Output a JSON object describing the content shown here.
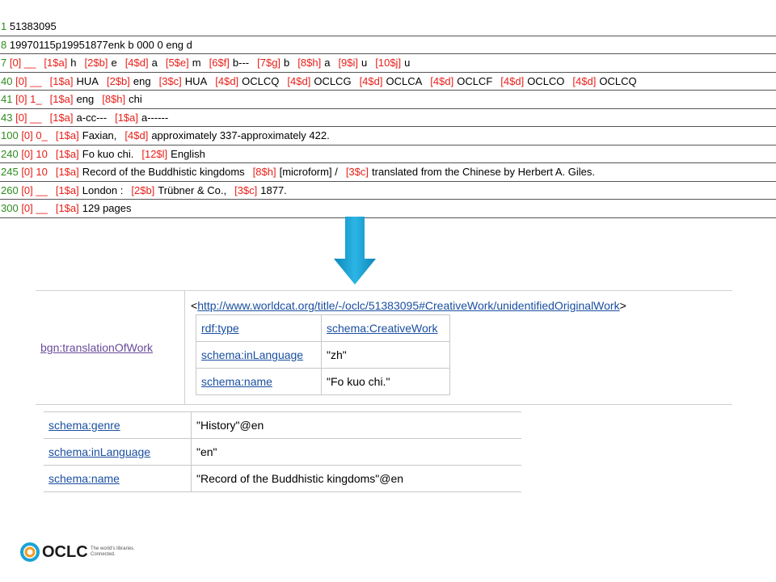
{
  "marc_rows": [
    {
      "tag": "1",
      "parts": [
        {
          "t": "51383095",
          "c": "plain"
        }
      ]
    },
    {
      "tag": "8",
      "parts": [
        {
          "t": "19970115p19951877enk b 000 0 eng d",
          "c": "plain"
        }
      ]
    },
    {
      "tag": "7",
      "parts": [
        {
          "t": "[0] __",
          "c": "sub"
        },
        {
          "t": "[1$a]",
          "c": "sub"
        },
        {
          "t": "h",
          "c": "plain"
        },
        {
          "t": "[2$b]",
          "c": "sub"
        },
        {
          "t": "e",
          "c": "plain"
        },
        {
          "t": "[4$d]",
          "c": "sub"
        },
        {
          "t": "a",
          "c": "plain"
        },
        {
          "t": "[5$e]",
          "c": "sub"
        },
        {
          "t": "m",
          "c": "plain"
        },
        {
          "t": "[6$f]",
          "c": "sub"
        },
        {
          "t": "b---",
          "c": "plain"
        },
        {
          "t": "[7$g]",
          "c": "sub"
        },
        {
          "t": "b",
          "c": "plain"
        },
        {
          "t": "[8$h]",
          "c": "sub"
        },
        {
          "t": "a",
          "c": "plain"
        },
        {
          "t": "[9$i]",
          "c": "sub"
        },
        {
          "t": "u",
          "c": "plain"
        },
        {
          "t": "[10$j]",
          "c": "sub"
        },
        {
          "t": "u",
          "c": "plain"
        }
      ]
    },
    {
      "tag": "40",
      "parts": [
        {
          "t": "[0] __",
          "c": "sub"
        },
        {
          "t": "[1$a]",
          "c": "sub"
        },
        {
          "t": "HUA",
          "c": "plain"
        },
        {
          "t": "[2$b]",
          "c": "sub"
        },
        {
          "t": "eng",
          "c": "plain"
        },
        {
          "t": "[3$c]",
          "c": "sub"
        },
        {
          "t": "HUA",
          "c": "plain"
        },
        {
          "t": "[4$d]",
          "c": "sub"
        },
        {
          "t": "OCLCQ",
          "c": "plain"
        },
        {
          "t": "[4$d]",
          "c": "sub"
        },
        {
          "t": "OCLCG",
          "c": "plain"
        },
        {
          "t": "[4$d]",
          "c": "sub"
        },
        {
          "t": "OCLCA",
          "c": "plain"
        },
        {
          "t": "[4$d]",
          "c": "sub"
        },
        {
          "t": "OCLCF",
          "c": "plain"
        },
        {
          "t": "[4$d]",
          "c": "sub"
        },
        {
          "t": "OCLCO",
          "c": "plain"
        },
        {
          "t": "[4$d]",
          "c": "sub"
        },
        {
          "t": "OCLCQ",
          "c": "plain"
        }
      ]
    },
    {
      "tag": "41",
      "parts": [
        {
          "t": "[0] 1_",
          "c": "sub"
        },
        {
          "t": "[1$a]",
          "c": "sub"
        },
        {
          "t": "eng",
          "c": "plain"
        },
        {
          "t": "[8$h]",
          "c": "sub"
        },
        {
          "t": "chi",
          "c": "plain"
        }
      ]
    },
    {
      "tag": "43",
      "parts": [
        {
          "t": "[0] __",
          "c": "sub"
        },
        {
          "t": "[1$a]",
          "c": "sub"
        },
        {
          "t": "a-cc---",
          "c": "plain"
        },
        {
          "t": "[1$a]",
          "c": "sub"
        },
        {
          "t": "a------",
          "c": "plain"
        }
      ]
    },
    {
      "tag": "100",
      "parts": [
        {
          "t": "[0] 0_",
          "c": "sub"
        },
        {
          "t": "[1$a]",
          "c": "sub"
        },
        {
          "t": "Faxian,",
          "c": "plain"
        },
        {
          "t": "[4$d]",
          "c": "sub"
        },
        {
          "t": "approximately 337-approximately 422.",
          "c": "plain"
        }
      ]
    },
    {
      "tag": "240",
      "parts": [
        {
          "t": "[0] 10",
          "c": "sub"
        },
        {
          "t": "[1$a]",
          "c": "sub"
        },
        {
          "t": "Fo kuo chi.",
          "c": "plain"
        },
        {
          "t": "[12$l]",
          "c": "sub"
        },
        {
          "t": "English",
          "c": "plain"
        }
      ]
    },
    {
      "tag": "245",
      "parts": [
        {
          "t": "[0] 10",
          "c": "sub"
        },
        {
          "t": "[1$a]",
          "c": "sub"
        },
        {
          "t": "Record of the Buddhistic kingdoms",
          "c": "plain"
        },
        {
          "t": "[8$h]",
          "c": "sub"
        },
        {
          "t": "[microform] /",
          "c": "plain"
        },
        {
          "t": "[3$c]",
          "c": "sub"
        },
        {
          "t": "translated from the Chinese by Herbert A. Giles.",
          "c": "plain"
        }
      ]
    },
    {
      "tag": "260",
      "parts": [
        {
          "t": "[0] __",
          "c": "sub"
        },
        {
          "t": "[1$a]",
          "c": "sub"
        },
        {
          "t": "London :",
          "c": "plain"
        },
        {
          "t": "[2$b]",
          "c": "sub"
        },
        {
          "t": "Trübner & Co.,",
          "c": "plain"
        },
        {
          "t": "[3$c]",
          "c": "sub"
        },
        {
          "t": "1877.",
          "c": "plain"
        }
      ]
    },
    {
      "tag": "300",
      "parts": [
        {
          "t": "[0] __",
          "c": "sub"
        },
        {
          "t": "[1$a]",
          "c": "sub"
        },
        {
          "t": "129 pages",
          "c": "plain"
        }
      ]
    }
  ],
  "rdf": {
    "property": "bgn:translationOfWork",
    "uri_open": "<",
    "uri": "http://www.worldcat.org/title/-/oclc/51383095#CreativeWork/unidentifiedOriginalWork",
    "uri_close": ">",
    "inner": [
      {
        "k": "rdf:type",
        "v": "schema:CreativeWork",
        "v_link": true
      },
      {
        "k": "schema:inLanguage",
        "v": "\"zh\"",
        "v_link": false
      },
      {
        "k": "schema:name",
        "v": "\"Fo kuo chi.\"",
        "v_link": false
      }
    ]
  },
  "outer": [
    {
      "k": "schema:genre",
      "v": "\"History\"@en"
    },
    {
      "k": "schema:inLanguage",
      "v": "\"en\""
    },
    {
      "k": "schema:name",
      "v": "\"Record of the Buddhistic kingdoms\"@en"
    }
  ],
  "logo": {
    "brand": "OCLC",
    "tagline_1": "The world's libraries.",
    "tagline_2": "Connected."
  },
  "colors": {
    "tag": "#2e8b1e",
    "subfield": "#e8201a",
    "link": "#1a4fa0",
    "visited_link": "#6a4b9c",
    "arrow": "#1ba3d6"
  }
}
